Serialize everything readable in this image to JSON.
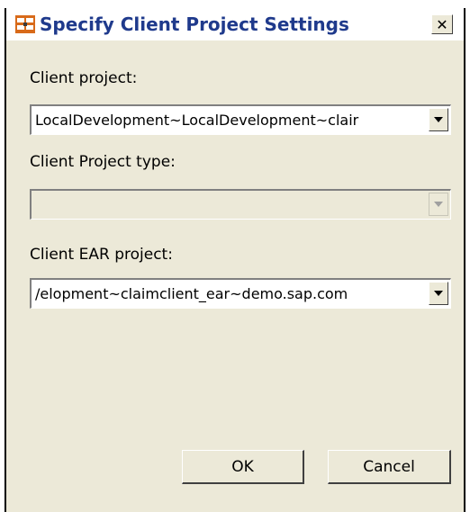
{
  "window": {
    "title": "Specify Client Project Settings",
    "close_glyph": "✕"
  },
  "fields": {
    "client_project": {
      "label": "Client project:",
      "value": "LocalDevelopment~LocalDevelopment~clair"
    },
    "client_project_type": {
      "label": "Client Project type:",
      "value": "",
      "disabled": true
    },
    "client_ear_project": {
      "label": "Client EAR project:",
      "value": "/elopment~claimclient_ear~demo.sap.com"
    }
  },
  "buttons": {
    "ok_label": "OK",
    "cancel_label": "Cancel"
  },
  "colors": {
    "dialog_bg": "#ece9d8",
    "title_text": "#1f3a8c"
  },
  "icons": {
    "app": "wizard-settings-icon",
    "dropdown": "chevron-down-icon",
    "close": "close-icon"
  }
}
